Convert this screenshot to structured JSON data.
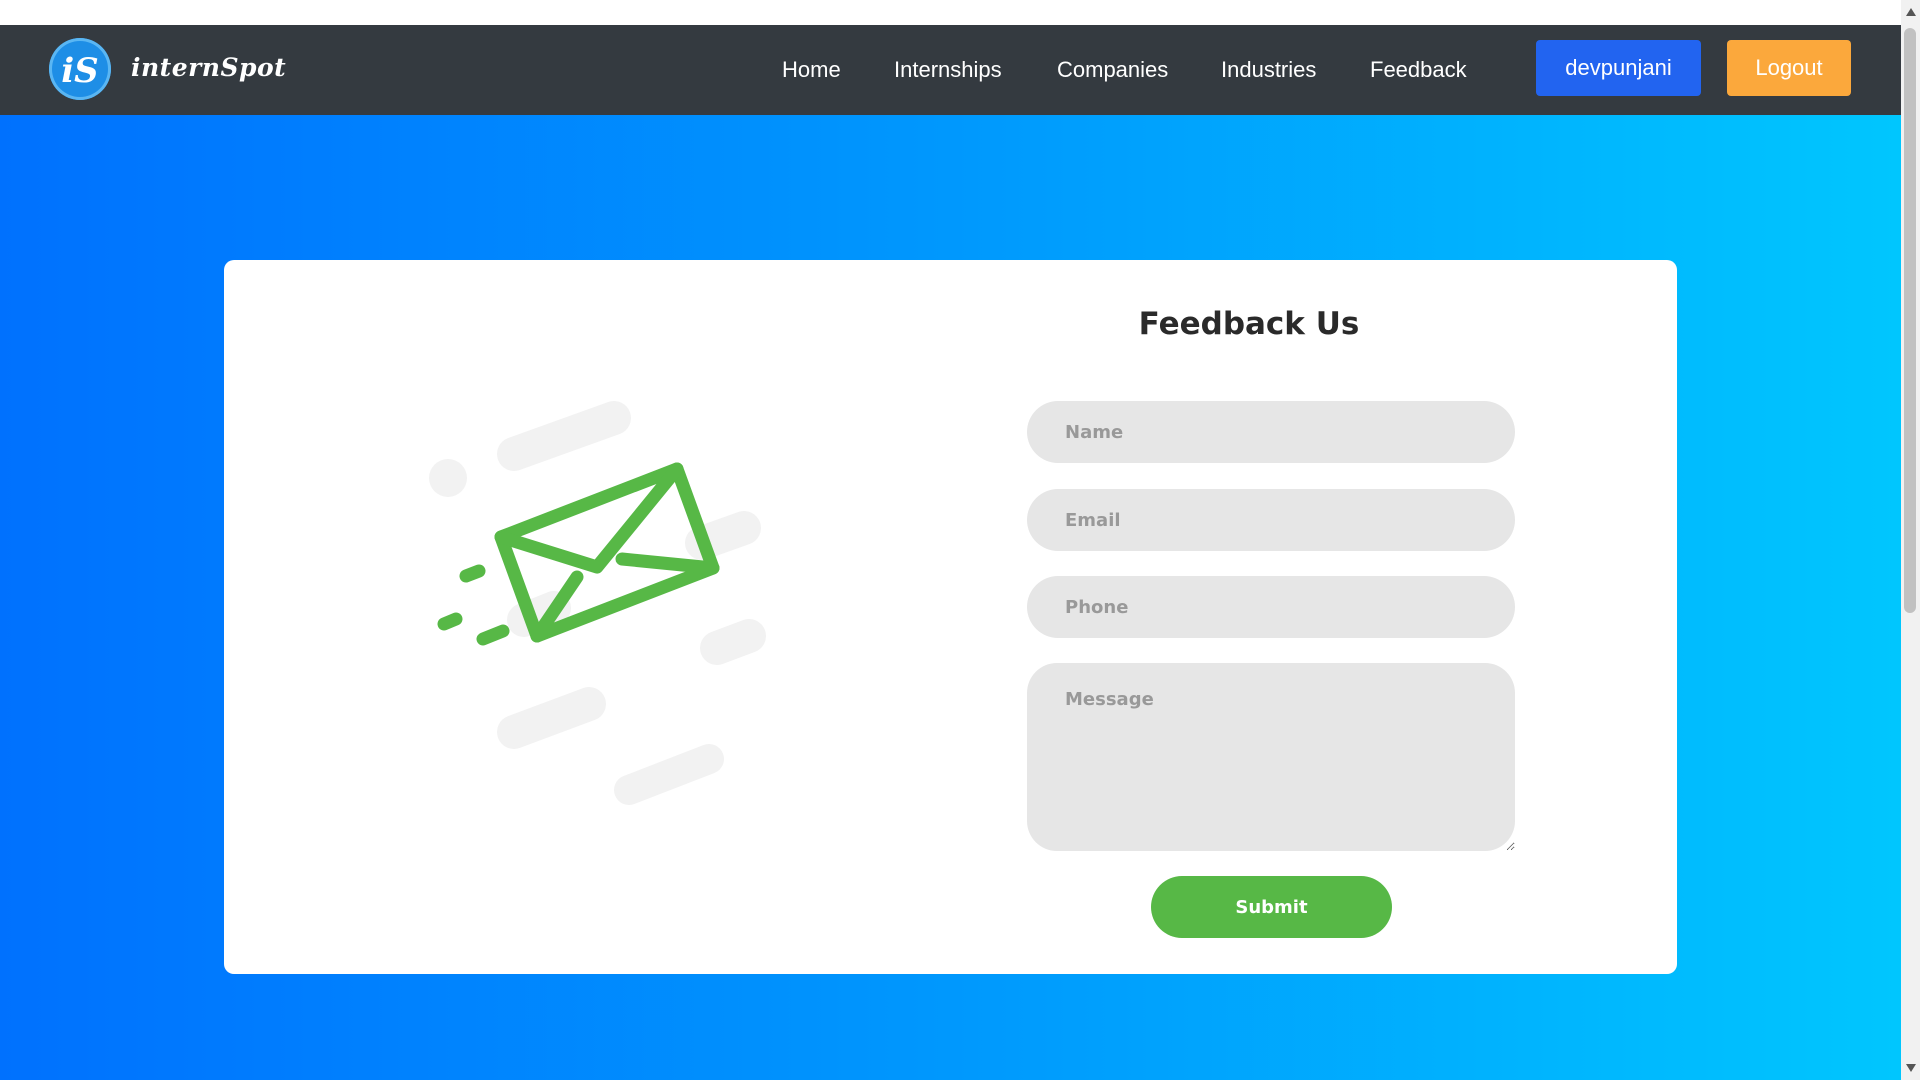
{
  "brand": {
    "name": "internSpot",
    "logo_text": "iS",
    "logo_color": "#1e8ee6"
  },
  "nav": {
    "links": [
      "Home",
      "Internships",
      "Companies",
      "Industries",
      "Feedback"
    ],
    "user_button": "devpunjani",
    "logout_button": "Logout"
  },
  "colors": {
    "navbar": "#343a40",
    "user_button": "#2264f0",
    "logout_button": "#fba83c",
    "gradient_start": "#0071fe",
    "gradient_end": "#00c6fe",
    "submit_button": "#57b846",
    "envelope": "#57b846"
  },
  "form": {
    "title": "Feedback Us",
    "name_placeholder": "Name",
    "email_placeholder": "Email",
    "phone_placeholder": "Phone",
    "message_placeholder": "Message",
    "submit_label": "Submit"
  },
  "illustration": {
    "icon": "envelope-icon"
  }
}
